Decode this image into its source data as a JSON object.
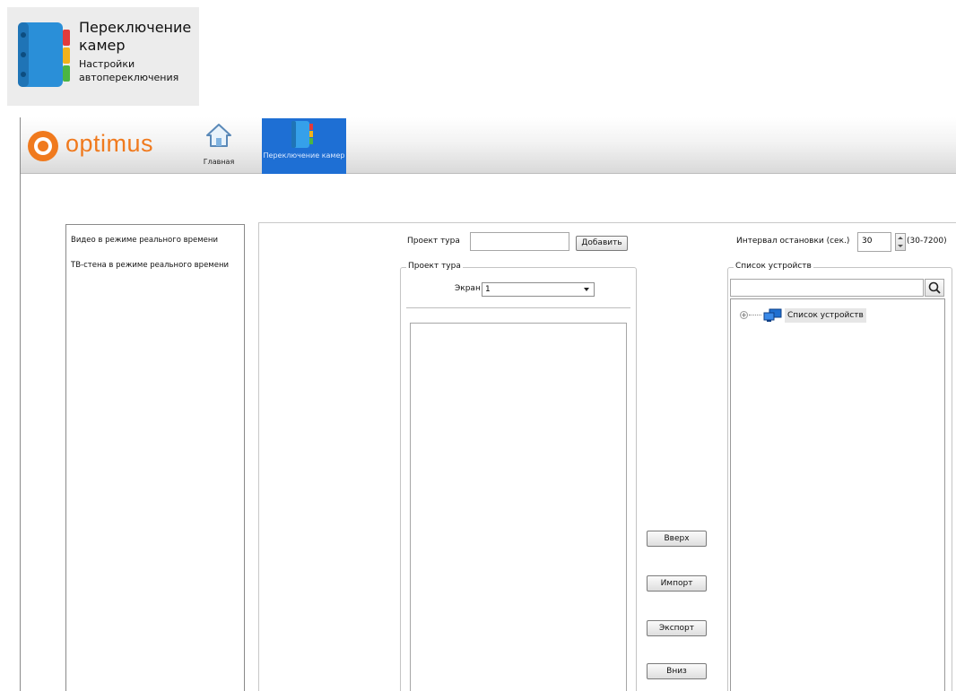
{
  "tooltip": {
    "title": "Переключение камер",
    "subtitle": "Настройки автопереключения"
  },
  "brand": {
    "name": "optimus",
    "color": "#f07a1e"
  },
  "nav": {
    "home_label": "Главная",
    "switch_label": "Переключение камер",
    "active_color": "#1e6fd4"
  },
  "menu": {
    "items": [
      {
        "label": "Видео в режиме реального времени"
      },
      {
        "label": "ТВ-стена в режиме реального времени"
      }
    ]
  },
  "tour": {
    "project_label": "Проект тура",
    "project_value": "",
    "add_button": "Добавить",
    "group_title": "Проект тура",
    "screen_label": "Экран",
    "screen_value": "1"
  },
  "interval": {
    "label": "Интервал остановки (сек.)",
    "value": "30",
    "range": "(30-7200)"
  },
  "devices": {
    "group_title": "Список устройств",
    "search_value": "",
    "tree_root": "Список устройств"
  },
  "actions": {
    "up": "Вверх",
    "import": "Импорт",
    "export": "Экспорт",
    "down": "Вниз"
  }
}
